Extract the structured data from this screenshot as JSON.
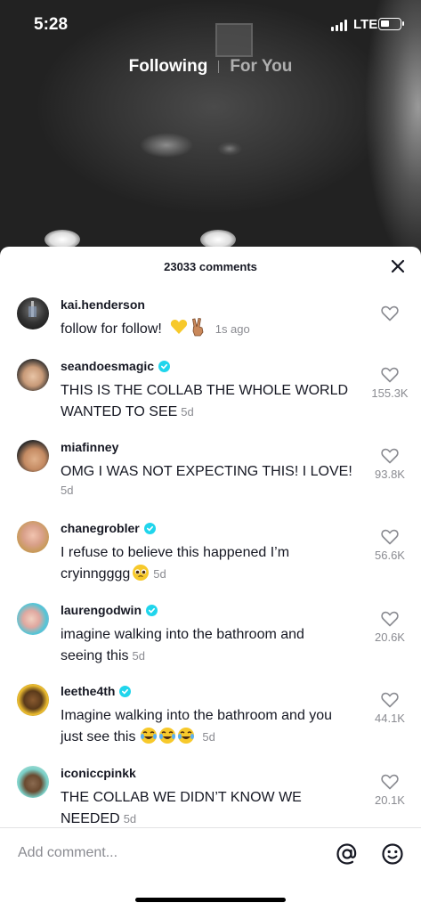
{
  "status_bar": {
    "time": "5:28",
    "network": "LTE"
  },
  "feed_tabs": {
    "following": "Following",
    "for_you": "For You"
  },
  "comments_header": {
    "count_label": "23033 comments"
  },
  "comments": [
    {
      "username": "kai.henderson",
      "verified": false,
      "text": "follow for follow! ",
      "time": "1s ago",
      "likes": ""
    },
    {
      "username": "seandoesmagic",
      "verified": true,
      "text": "THIS IS THE COLLAB THE WHOLE WORLD WANTED TO SEE",
      "time": "5d",
      "likes": "155.3K"
    },
    {
      "username": "miafinney",
      "verified": false,
      "text": "OMG I WAS NOT EXPECTING THIS! I LOVE!",
      "time": "5d",
      "likes": "93.8K"
    },
    {
      "username": "chanegrobler",
      "verified": true,
      "text": "I refuse to believe this happened I’m cryinngggg",
      "time": "5d",
      "likes": "56.6K"
    },
    {
      "username": "laurengodwin",
      "verified": true,
      "text": "imagine walking into the bathroom and seeing this",
      "time": "5d",
      "likes": "20.6K"
    },
    {
      "username": "leethe4th",
      "verified": true,
      "text": "Imagine walking into the bathroom and you just see this ",
      "time": "5d",
      "likes": "44.1K"
    },
    {
      "username": "iconiccpinkk",
      "verified": false,
      "text": "THE COLLAB WE DIDN’T KNOW WE NEEDED",
      "time": "5d",
      "likes": "20.1K"
    }
  ],
  "input": {
    "placeholder": "Add comment..."
  },
  "colors": {
    "verified": "#20d5ec",
    "text": "#161823",
    "muted": "#8a8b91"
  }
}
